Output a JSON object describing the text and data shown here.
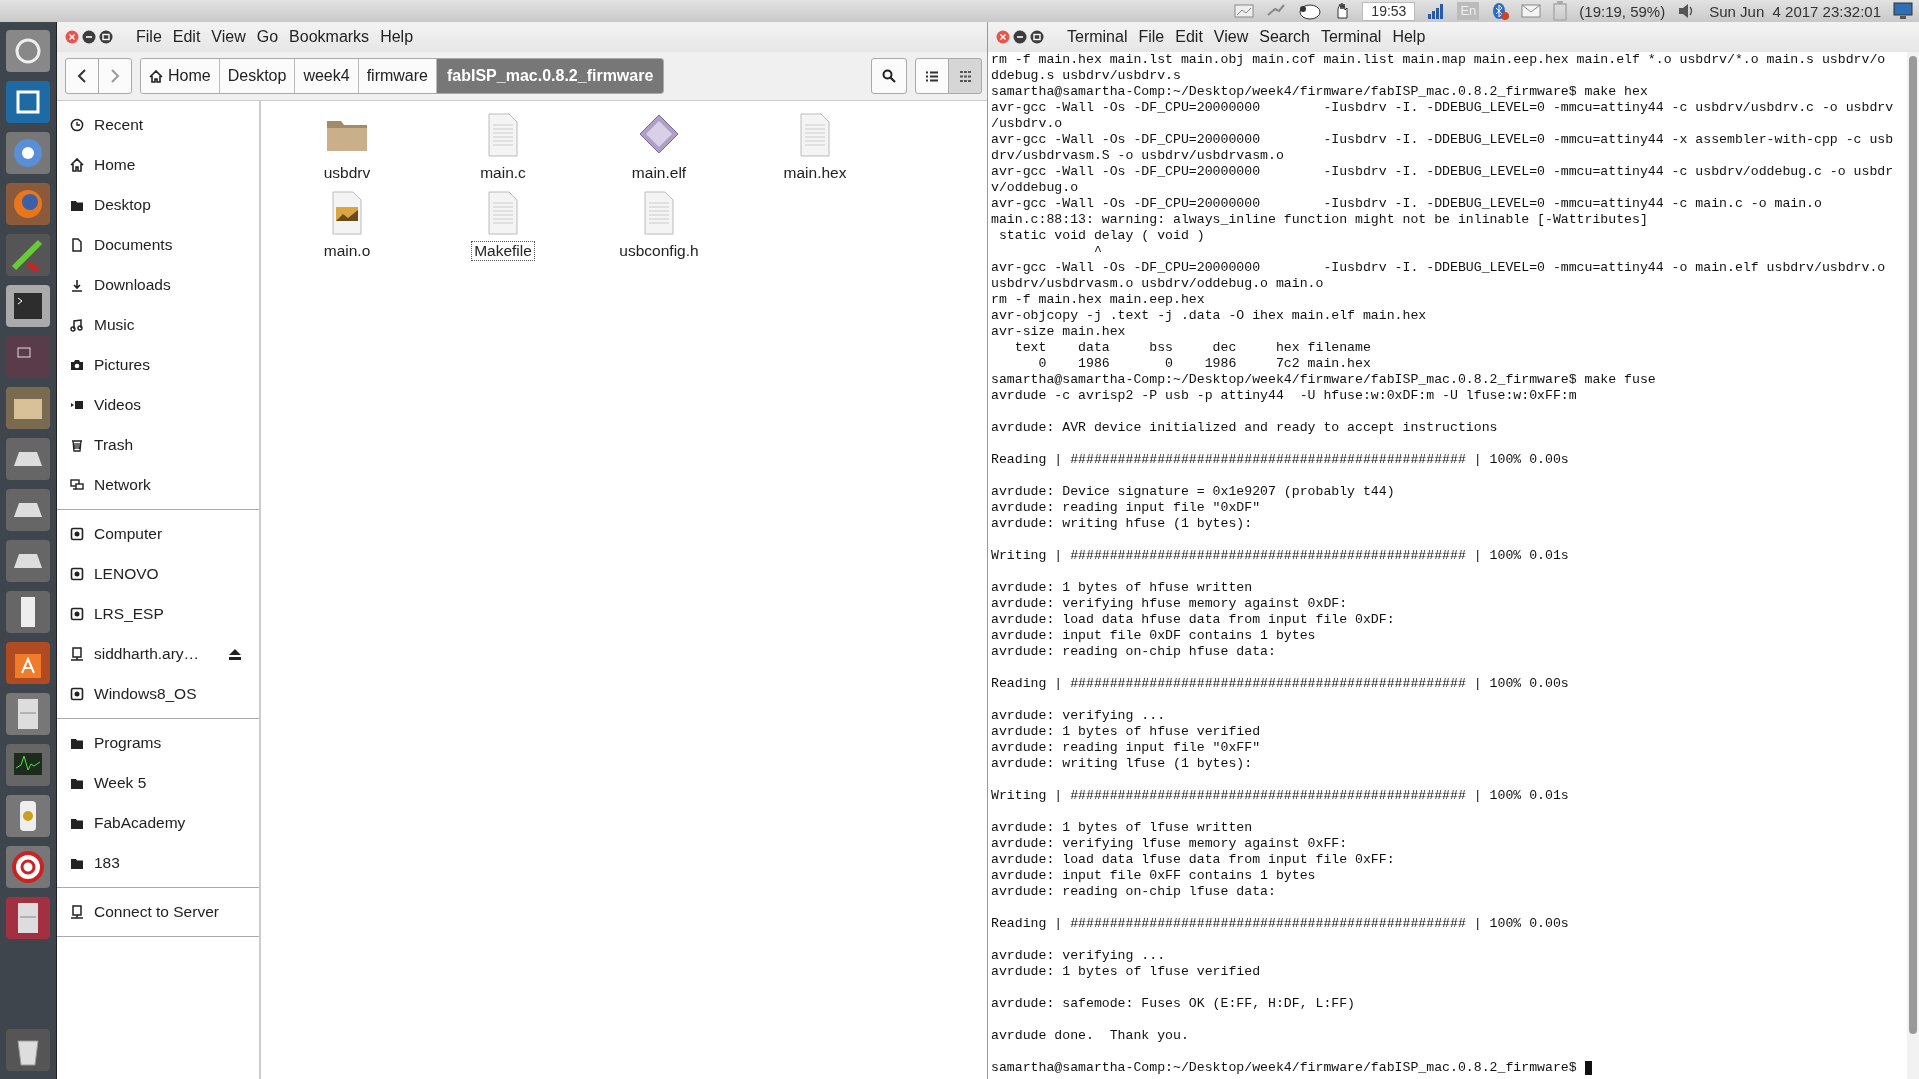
{
  "top_panel": {
    "clock_box": "19:53",
    "keyboard": "En",
    "battery": "(19:19, 59%)",
    "datetime": "Sun Jun  4 2017 23:32:01"
  },
  "file_manager": {
    "menu": [
      "File",
      "Edit",
      "View",
      "Go",
      "Bookmarks",
      "Help"
    ],
    "breadcrumb": [
      {
        "label": "Home",
        "kind": "home",
        "selected": false
      },
      {
        "label": "Desktop",
        "kind": "plain",
        "selected": false
      },
      {
        "label": "week4",
        "kind": "plain",
        "selected": false
      },
      {
        "label": "firmware",
        "kind": "plain",
        "selected": false
      },
      {
        "label": "fabISP_mac.0.8.2_firmware",
        "kind": "plain",
        "selected": true
      }
    ],
    "view_buttons": [
      {
        "kind": "list",
        "selected": false
      },
      {
        "kind": "grid",
        "selected": true
      }
    ],
    "sidebar": [
      {
        "items": [
          {
            "label": "Recent",
            "kind": "clock"
          },
          {
            "label": "Home",
            "kind": "home"
          },
          {
            "label": "Desktop",
            "kind": "folder"
          },
          {
            "label": "Documents",
            "kind": "document"
          },
          {
            "label": "Downloads",
            "kind": "download"
          },
          {
            "label": "Music",
            "kind": "music"
          },
          {
            "label": "Pictures",
            "kind": "camera"
          },
          {
            "label": "Videos",
            "kind": "video"
          },
          {
            "label": "Trash",
            "kind": "trash"
          },
          {
            "label": "Network",
            "kind": "network"
          }
        ]
      },
      {
        "items": [
          {
            "label": "Computer",
            "kind": "drive",
            "eject": false
          },
          {
            "label": "LENOVO",
            "kind": "drive",
            "eject": false
          },
          {
            "label": "LRS_ESP",
            "kind": "drive",
            "eject": false
          },
          {
            "label": "siddharth.ary…",
            "kind": "remote",
            "eject": true
          },
          {
            "label": "Windows8_OS",
            "kind": "drive",
            "eject": false
          }
        ]
      },
      {
        "items": [
          {
            "label": "Programs",
            "kind": "folder"
          },
          {
            "label": "Week 5",
            "kind": "folder"
          },
          {
            "label": "FabAcademy",
            "kind": "folder"
          },
          {
            "label": "183",
            "kind": "folder"
          }
        ]
      },
      {
        "items": [
          {
            "label": "Connect to Server",
            "kind": "remote"
          }
        ]
      }
    ],
    "files": [
      {
        "name": "usbdrv",
        "kind": "folder",
        "focused": false
      },
      {
        "name": "main.c",
        "kind": "text",
        "focused": false
      },
      {
        "name": "main.elf",
        "kind": "binary",
        "focused": false
      },
      {
        "name": "main.hex",
        "kind": "text",
        "focused": false
      },
      {
        "name": "main.o",
        "kind": "image",
        "focused": false
      },
      {
        "name": "Makefile",
        "kind": "text",
        "focused": true
      },
      {
        "name": "usbconfig.h",
        "kind": "text",
        "focused": false
      }
    ]
  },
  "terminal": {
    "app_name": "Terminal",
    "menu": [
      "File",
      "Edit",
      "View",
      "Search",
      "Terminal",
      "Help"
    ],
    "cursor": true,
    "blocks": [
      [
        "rm -f main.hex main.lst main.obj main.cof main.list main.map main.eep.hex main.elf *.o usbdrv/*.o main.s usbdrv/o",
        "ddebug.s usbdrv/usbdrv.s",
        "samartha@samartha-Comp:~/Desktop/week4/firmware/fabISP_mac.0.8.2_firmware$ make hex",
        "avr-gcc -Wall -Os -DF_CPU=20000000        -Iusbdrv -I. -DDEBUG_LEVEL=0 -mmcu=attiny44 -c usbdrv/usbdrv.c -o usbdrv",
        "/usbdrv.o",
        "avr-gcc -Wall -Os -DF_CPU=20000000        -Iusbdrv -I. -DDEBUG_LEVEL=0 -mmcu=attiny44 -x assembler-with-cpp -c usb",
        "drv/usbdrvasm.S -o usbdrv/usbdrvasm.o",
        "avr-gcc -Wall -Os -DF_CPU=20000000        -Iusbdrv -I. -DDEBUG_LEVEL=0 -mmcu=attiny44 -c usbdrv/oddebug.c -o usbdr",
        "v/oddebug.o",
        "avr-gcc -Wall -Os -DF_CPU=20000000        -Iusbdrv -I. -DDEBUG_LEVEL=0 -mmcu=attiny44 -c main.c -o main.o",
        "main.c:88:13: warning: always_inline function might not be inlinable [-Wattributes]",
        " static void delay ( void )",
        "             ^",
        "avr-gcc -Wall -Os -DF_CPU=20000000        -Iusbdrv -I. -DDEBUG_LEVEL=0 -mmcu=attiny44 -o main.elf usbdrv/usbdrv.o",
        "usbdrv/usbdrvasm.o usbdrv/oddebug.o main.o",
        "rm -f main.hex main.eep.hex",
        "avr-objcopy -j .text -j .data -O ihex main.elf main.hex",
        "avr-size main.hex",
        "   text    data     bss     dec     hex filename",
        "      0    1986       0    1986     7c2 main.hex",
        "samartha@samartha-Comp:~/Desktop/week4/firmware/fabISP_mac.0.8.2_firmware$ make fuse",
        "avrdude -c avrisp2 -P usb -p attiny44  -U hfuse:w:0xDF:m -U lfuse:w:0xFF:m"
      ],
      [
        "avrdude: AVR device initialized and ready to accept instructions"
      ],
      [
        "Reading | ################################################## | 100% 0.00s"
      ],
      [
        "avrdude: Device signature = 0x1e9207 (probably t44)",
        "avrdude: reading input file \"0xDF\"",
        "avrdude: writing hfuse (1 bytes):"
      ],
      [
        "Writing | ################################################## | 100% 0.01s"
      ],
      [
        "avrdude: 1 bytes of hfuse written",
        "avrdude: verifying hfuse memory against 0xDF:",
        "avrdude: load data hfuse data from input file 0xDF:",
        "avrdude: input file 0xDF contains 1 bytes",
        "avrdude: reading on-chip hfuse data:"
      ],
      [
        "Reading | ################################################## | 100% 0.00s"
      ],
      [
        "avrdude: verifying ...",
        "avrdude: 1 bytes of hfuse verified",
        "avrdude: reading input file \"0xFF\"",
        "avrdude: writing lfuse (1 bytes):"
      ],
      [
        "Writing | ################################################## | 100% 0.01s"
      ],
      [
        "avrdude: 1 bytes of lfuse written",
        "avrdude: verifying lfuse memory against 0xFF:",
        "avrdude: load data lfuse data from input file 0xFF:",
        "avrdude: input file 0xFF contains 1 bytes",
        "avrdude: reading on-chip lfuse data:"
      ],
      [
        "Reading | ################################################## | 100% 0.00s"
      ],
      [
        "avrdude: verifying ...",
        "avrdude: 1 bytes of lfuse verified"
      ],
      [
        "avrdude: safemode: Fuses OK (E:FF, H:DF, L:FF)"
      ],
      [
        "avrdude done.  Thank you."
      ],
      [
        "samartha@samartha-Comp:~/Desktop/week4/firmware/fabISP_mac.0.8.2_firmware$ "
      ]
    ]
  }
}
